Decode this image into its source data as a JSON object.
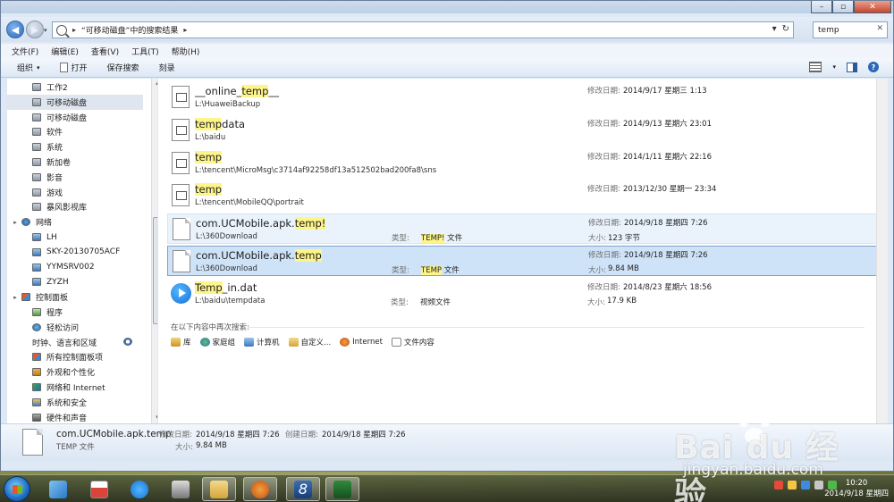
{
  "address": {
    "crumb": "“可移动磁盘”中的搜索结果",
    "search_value": "temp"
  },
  "menu": [
    "文件(F)",
    "编辑(E)",
    "查看(V)",
    "工具(T)",
    "帮助(H)"
  ],
  "toolbar": {
    "organize": "组织",
    "open": "打开",
    "save_search": "保存搜索",
    "burn": "刻录"
  },
  "nav_items": [
    {
      "label": "工作2",
      "icon": "drive-icon",
      "indent": 2
    },
    {
      "label": "可移动磁盘",
      "icon": "removable-drive-icon",
      "indent": 2,
      "selected": true
    },
    {
      "label": "可移动磁盘",
      "icon": "removable-drive-icon",
      "indent": 2
    },
    {
      "label": "软件",
      "icon": "drive-icon",
      "indent": 2
    },
    {
      "label": "系统",
      "icon": "drive-icon",
      "indent": 2
    },
    {
      "label": "新加卷",
      "icon": "drive-icon",
      "indent": 2
    },
    {
      "label": "影音",
      "icon": "drive-icon",
      "indent": 2
    },
    {
      "label": "游戏",
      "icon": "drive-icon",
      "indent": 2
    },
    {
      "label": "暴风影视库",
      "icon": "drive-icon",
      "indent": 2
    },
    {
      "label": "网络",
      "icon": "network-icon",
      "indent": 1
    },
    {
      "label": "LH",
      "icon": "computer-icon",
      "indent": 2
    },
    {
      "label": "SKY-20130705ACF",
      "icon": "computer-icon",
      "indent": 2
    },
    {
      "label": "YYMSRV002",
      "icon": "computer-icon",
      "indent": 2
    },
    {
      "label": "ZYZH",
      "icon": "computer-icon",
      "indent": 2
    },
    {
      "label": "控制面板",
      "icon": "control-panel-icon",
      "indent": 1
    },
    {
      "label": "程序",
      "icon": "programs-icon",
      "indent": 2
    },
    {
      "label": "轻松访问",
      "icon": "ease-of-access-icon",
      "indent": 2
    },
    {
      "label": "时钟、语言和区域",
      "icon": "clock-icon",
      "indent": 2
    },
    {
      "label": "所有控制面板项",
      "icon": "control-panel-icon",
      "indent": 2
    },
    {
      "label": "外观和个性化",
      "icon": "appearance-icon",
      "indent": 2
    },
    {
      "label": "网络和 Internet",
      "icon": "network-internet-icon",
      "indent": 2
    },
    {
      "label": "系统和安全",
      "icon": "shield-icon",
      "indent": 2
    },
    {
      "label": "硬件和声音",
      "icon": "hardware-sound-icon",
      "indent": 2
    }
  ],
  "results": [
    {
      "name_pre": "__online_",
      "name_hl": "temp",
      "name_post": "__",
      "path": "L:\\HuaweiBackup",
      "type_label": "",
      "type_hl": "",
      "type_post": "",
      "date_label": "修改日期:",
      "date": "2014/9/17 星期三 1:13",
      "size_label": "",
      "size": "",
      "icon": "text-file-icon"
    },
    {
      "name_pre": "",
      "name_hl": "temp",
      "name_post": "data",
      "path": "L:\\baidu",
      "type_label": "",
      "type_hl": "",
      "type_post": "",
      "date_label": "修改日期:",
      "date": "2014/9/13 星期六 23:01",
      "size_label": "",
      "size": "",
      "icon": "text-file-icon"
    },
    {
      "name_pre": "",
      "name_hl": "temp",
      "name_post": "",
      "path": "L:\\tencent\\MicroMsg\\c3714af92258df13a512502bad200fa8\\sns",
      "type_label": "",
      "type_hl": "",
      "type_post": "",
      "date_label": "修改日期:",
      "date": "2014/1/11 星期六 22:16",
      "size_label": "",
      "size": "",
      "icon": "text-file-icon"
    },
    {
      "name_pre": "",
      "name_hl": "temp",
      "name_post": "",
      "path": "L:\\tencent\\MobileQQ\\portrait",
      "type_label": "",
      "type_hl": "",
      "type_post": "",
      "date_label": "修改日期:",
      "date": "2013/12/30 星期一 23:34",
      "size_label": "",
      "size": "",
      "icon": "text-file-icon"
    },
    {
      "name_pre": "com.UCMobile.apk.",
      "name_hl": "temp!",
      "name_post": "",
      "path": "L:\\360Download",
      "type_label": "类型:",
      "type_hl": "TEMP!",
      "type_post": " 文件",
      "date_label": "修改日期:",
      "date": "2014/9/18 星期四 7:26",
      "size_label": "大小:",
      "size": "123 字节",
      "icon": "blank-file-icon"
    },
    {
      "name_pre": "com.UCMobile.apk.",
      "name_hl": "temp",
      "name_post": "",
      "path": "L:\\360Download",
      "type_label": "类型:",
      "type_hl": "TEMP",
      "type_post": " 文件",
      "date_label": "修改日期:",
      "date": "2014/9/18 星期四 7:26",
      "size_label": "大小:",
      "size": "9.84 MB",
      "icon": "blank-file-icon"
    },
    {
      "name_pre": "",
      "name_hl": "Temp",
      "name_post": "_in.dat",
      "path": "L:\\baidu\\tempdata",
      "type_label": "类型:",
      "type_hl": "",
      "type_post": "视频文件",
      "date_label": "修改日期:",
      "date": "2014/8/23 星期六 18:56",
      "size_label": "大小:",
      "size": "17.9 KB",
      "icon": "video-file-icon"
    }
  ],
  "search_again": {
    "label": "在以下内容中再次搜索:",
    "links": [
      "库",
      "家庭组",
      "计算机",
      "自定义...",
      "Internet",
      "文件内容"
    ]
  },
  "details": {
    "name": "com.UCMobile.apk.temp",
    "type": "TEMP 文件",
    "modified_label": "修改日期:",
    "modified": "2014/9/18 星期四 7:26",
    "created_label": "创建日期:",
    "created": "2014/9/18 星期四 7:26",
    "size_label": "大小:",
    "size": "9.84 MB"
  },
  "taskbar": {
    "time": "10:20",
    "date": "2014/9/18 星期四"
  },
  "watermark": {
    "big": "Bai du 经验",
    "small": "jingyan.baidu.com"
  }
}
